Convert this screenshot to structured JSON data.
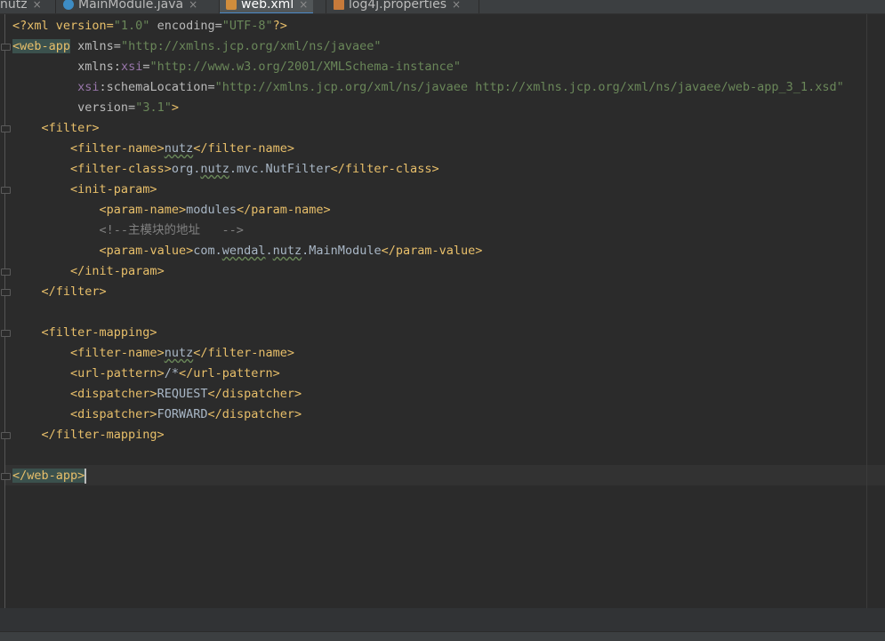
{
  "tabs": [
    {
      "label": "nutz",
      "close": "×"
    },
    {
      "label": "MainModule.java",
      "close": "×"
    },
    {
      "label": "web.xml",
      "close": "×"
    },
    {
      "label": "log4j.properties",
      "close": "×"
    }
  ],
  "code": {
    "l1": {
      "a": "<?xml version=",
      "b": "\"1.0\"",
      "c": " encoding=",
      "d": "\"UTF-8\"",
      "e": "?>"
    },
    "l2": {
      "a": "<web-app",
      "b": " xmlns=",
      "c": "\"http://xmlns.jcp.org/xml/ns/javaee\""
    },
    "l3": {
      "pad": "         ",
      "a": "xmlns:",
      "b": "xsi",
      "c": "=",
      "d": "\"http://www.w3.org/2001/XMLSchema-instance\""
    },
    "l4": {
      "pad": "         ",
      "a": "xsi",
      "b": ":schemaLocation=",
      "c": "\"http://xmlns.jcp.org/xml/ns/javaee http://xmlns.jcp.org/xml/ns/javaee/web-app_3_1.xsd\""
    },
    "l5": {
      "pad": "         ",
      "a": "version=",
      "b": "\"3.1\"",
      "c": ">"
    },
    "l6": {
      "pad": "    ",
      "a": "<filter>"
    },
    "l7": {
      "pad": "        ",
      "a": "<filter-name>",
      "b": "nutz",
      "c": "</filter-name>"
    },
    "l8": {
      "pad": "        ",
      "a": "<filter-class>",
      "b": "org.",
      "c": "nutz",
      ".d": ".mvc.NutFilter",
      "e": "</filter-class>"
    },
    "l9": {
      "pad": "        ",
      "a": "<init-param>"
    },
    "l10": {
      "pad": "            ",
      "a": "<param-name>",
      "b": "modules",
      "c": "</param-name>"
    },
    "l11": {
      "pad": "            ",
      "a": "<!--主模块的地址   -->"
    },
    "l12": {
      "pad": "            ",
      "a": "<param-value>",
      "b": "com.",
      "c": "wendal",
      ".d": ".",
      "e": "nutz",
      "f": ".MainModule",
      "g": "</param-value>"
    },
    "l13": {
      "pad": "        ",
      "a": "</init-param>"
    },
    "l14": {
      "pad": "    ",
      "a": "</filter>"
    },
    "l15": {
      "pad": ""
    },
    "l16": {
      "pad": "    ",
      "a": "<filter-mapping>"
    },
    "l17": {
      "pad": "        ",
      "a": "<filter-name>",
      "b": "nutz",
      "c": "</filter-name>"
    },
    "l18": {
      "pad": "        ",
      "a": "<url-pattern>",
      "b": "/*",
      "c": "</url-pattern>"
    },
    "l19": {
      "pad": "        ",
      "a": "<dispatcher>",
      "b": "REQUEST",
      "c": "</dispatcher>"
    },
    "l20": {
      "pad": "        ",
      "a": "<dispatcher>",
      "b": "FORWARD",
      "c": "</dispatcher>"
    },
    "l21": {
      "pad": "    ",
      "a": "</filter-mapping>"
    },
    "l22": {
      "pad": ""
    },
    "l23": {
      "a": "</web-app>"
    }
  },
  "colors": {
    "tag": "#e8bf6a",
    "attribute": "#bababa",
    "value": "#6a8759",
    "namespace": "#9876aa",
    "comment": "#808080",
    "active_tab_accent": "#4a88c7"
  }
}
